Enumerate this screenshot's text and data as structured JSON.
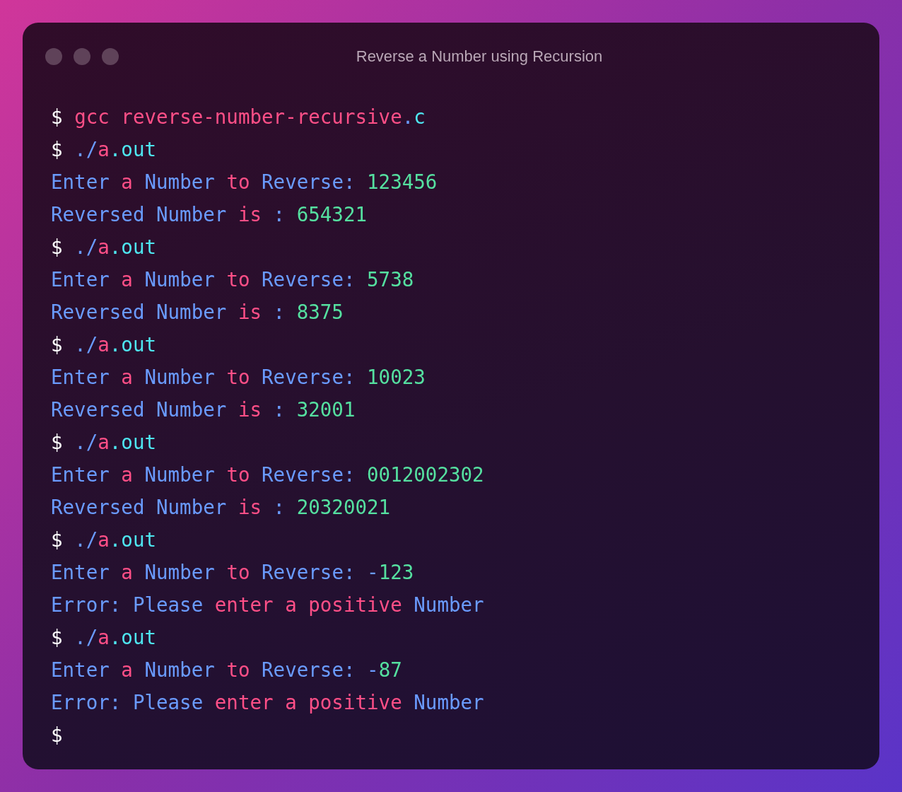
{
  "window": {
    "title": "Reverse a Number using Recursion"
  },
  "lines": [
    [
      {
        "text": "$ ",
        "color": "#ffffff"
      },
      {
        "text": "gcc reverse-number-recursive",
        "color": "#ff4f87"
      },
      {
        "text": ".",
        "color": "#6a9bff"
      },
      {
        "text": "c",
        "color": "#4ee6f0"
      }
    ],
    [
      {
        "text": "$ ",
        "color": "#ffffff"
      },
      {
        "text": "./",
        "color": "#6a9bff"
      },
      {
        "text": "a",
        "color": "#ff4f87"
      },
      {
        "text": ".out",
        "color": "#4ee6f0"
      }
    ],
    [
      {
        "text": "Enter ",
        "color": "#6a9bff"
      },
      {
        "text": "a ",
        "color": "#ff4f87"
      },
      {
        "text": "Number ",
        "color": "#6a9bff"
      },
      {
        "text": "to ",
        "color": "#ff4f87"
      },
      {
        "text": "Reverse: ",
        "color": "#6a9bff"
      },
      {
        "text": "123456",
        "color": "#55e0a0"
      }
    ],
    [
      {
        "text": "Reversed Number ",
        "color": "#6a9bff"
      },
      {
        "text": "is ",
        "color": "#ff4f87"
      },
      {
        "text": ": ",
        "color": "#6a9bff"
      },
      {
        "text": "654321",
        "color": "#55e0a0"
      }
    ],
    [
      {
        "text": "$ ",
        "color": "#ffffff"
      },
      {
        "text": "./",
        "color": "#6a9bff"
      },
      {
        "text": "a",
        "color": "#ff4f87"
      },
      {
        "text": ".out",
        "color": "#4ee6f0"
      }
    ],
    [
      {
        "text": "Enter ",
        "color": "#6a9bff"
      },
      {
        "text": "a ",
        "color": "#ff4f87"
      },
      {
        "text": "Number ",
        "color": "#6a9bff"
      },
      {
        "text": "to ",
        "color": "#ff4f87"
      },
      {
        "text": "Reverse: ",
        "color": "#6a9bff"
      },
      {
        "text": "5738",
        "color": "#55e0a0"
      }
    ],
    [
      {
        "text": "Reversed Number ",
        "color": "#6a9bff"
      },
      {
        "text": "is ",
        "color": "#ff4f87"
      },
      {
        "text": ": ",
        "color": "#6a9bff"
      },
      {
        "text": "8375",
        "color": "#55e0a0"
      }
    ],
    [
      {
        "text": "$ ",
        "color": "#ffffff"
      },
      {
        "text": "./",
        "color": "#6a9bff"
      },
      {
        "text": "a",
        "color": "#ff4f87"
      },
      {
        "text": ".out",
        "color": "#4ee6f0"
      }
    ],
    [
      {
        "text": "Enter ",
        "color": "#6a9bff"
      },
      {
        "text": "a ",
        "color": "#ff4f87"
      },
      {
        "text": "Number ",
        "color": "#6a9bff"
      },
      {
        "text": "to ",
        "color": "#ff4f87"
      },
      {
        "text": "Reverse: ",
        "color": "#6a9bff"
      },
      {
        "text": "10023",
        "color": "#55e0a0"
      }
    ],
    [
      {
        "text": "Reversed Number ",
        "color": "#6a9bff"
      },
      {
        "text": "is ",
        "color": "#ff4f87"
      },
      {
        "text": ": ",
        "color": "#6a9bff"
      },
      {
        "text": "32001",
        "color": "#55e0a0"
      }
    ],
    [
      {
        "text": "$ ",
        "color": "#ffffff"
      },
      {
        "text": "./",
        "color": "#6a9bff"
      },
      {
        "text": "a",
        "color": "#ff4f87"
      },
      {
        "text": ".out",
        "color": "#4ee6f0"
      }
    ],
    [
      {
        "text": "Enter ",
        "color": "#6a9bff"
      },
      {
        "text": "a ",
        "color": "#ff4f87"
      },
      {
        "text": "Number ",
        "color": "#6a9bff"
      },
      {
        "text": "to ",
        "color": "#ff4f87"
      },
      {
        "text": "Reverse: ",
        "color": "#6a9bff"
      },
      {
        "text": "0012002302",
        "color": "#55e0a0"
      }
    ],
    [
      {
        "text": "Reversed Number ",
        "color": "#6a9bff"
      },
      {
        "text": "is ",
        "color": "#ff4f87"
      },
      {
        "text": ": ",
        "color": "#6a9bff"
      },
      {
        "text": "20320021",
        "color": "#55e0a0"
      }
    ],
    [
      {
        "text": "$ ",
        "color": "#ffffff"
      },
      {
        "text": "./",
        "color": "#6a9bff"
      },
      {
        "text": "a",
        "color": "#ff4f87"
      },
      {
        "text": ".out",
        "color": "#4ee6f0"
      }
    ],
    [
      {
        "text": "Enter ",
        "color": "#6a9bff"
      },
      {
        "text": "a ",
        "color": "#ff4f87"
      },
      {
        "text": "Number ",
        "color": "#6a9bff"
      },
      {
        "text": "to ",
        "color": "#ff4f87"
      },
      {
        "text": "Reverse: -",
        "color": "#6a9bff"
      },
      {
        "text": "123",
        "color": "#55e0a0"
      }
    ],
    [
      {
        "text": "Error: Please ",
        "color": "#6a9bff"
      },
      {
        "text": "enter a positive ",
        "color": "#ff4f87"
      },
      {
        "text": "Number",
        "color": "#6a9bff"
      }
    ],
    [
      {
        "text": "$ ",
        "color": "#ffffff"
      },
      {
        "text": "./",
        "color": "#6a9bff"
      },
      {
        "text": "a",
        "color": "#ff4f87"
      },
      {
        "text": ".out",
        "color": "#4ee6f0"
      }
    ],
    [
      {
        "text": "Enter ",
        "color": "#6a9bff"
      },
      {
        "text": "a ",
        "color": "#ff4f87"
      },
      {
        "text": "Number ",
        "color": "#6a9bff"
      },
      {
        "text": "to ",
        "color": "#ff4f87"
      },
      {
        "text": "Reverse: -",
        "color": "#6a9bff"
      },
      {
        "text": "87",
        "color": "#55e0a0"
      }
    ],
    [
      {
        "text": "Error: Please ",
        "color": "#6a9bff"
      },
      {
        "text": "enter a positive ",
        "color": "#ff4f87"
      },
      {
        "text": "Number",
        "color": "#6a9bff"
      }
    ],
    [
      {
        "text": "$",
        "color": "#ffffff"
      }
    ]
  ]
}
